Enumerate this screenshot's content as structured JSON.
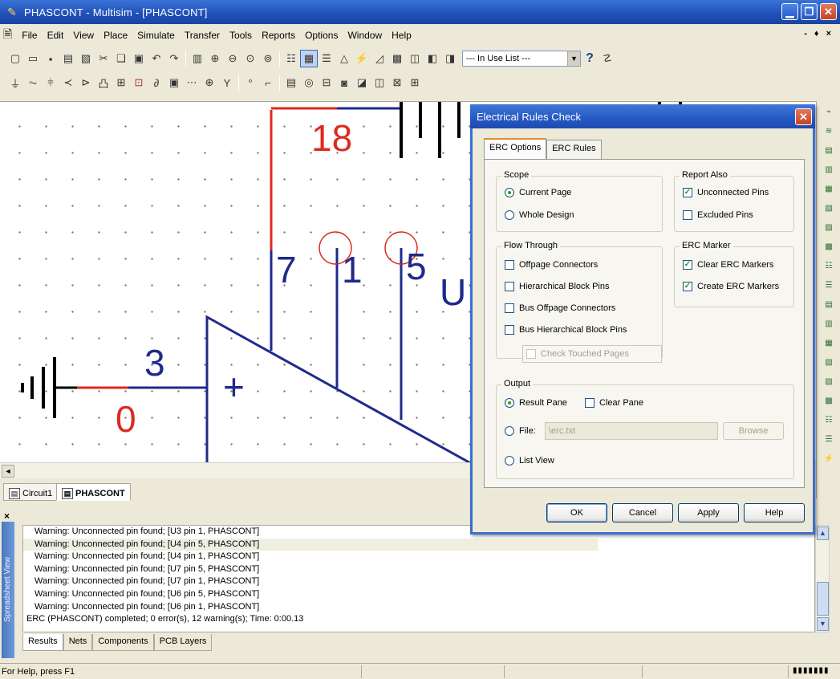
{
  "window": {
    "title": "PHASCONT - Multisim - [PHASCONT]"
  },
  "menu": [
    "File",
    "Edit",
    "View",
    "Place",
    "Simulate",
    "Transfer",
    "Tools",
    "Reports",
    "Options",
    "Window",
    "Help"
  ],
  "toolbar": {
    "in_use_list": "--- In Use List ---",
    "help_icon": "?"
  },
  "schematic": {
    "labels": {
      "n18": "18",
      "n7": "7",
      "n1": "1",
      "n5": "5",
      "nU": "U",
      "n3": "3",
      "n0": "0",
      "plus": "+"
    },
    "colors": {
      "wire_blue": "#1f2a8a",
      "wire_red": "#dd2a1f",
      "grid_dot": "#777777"
    }
  },
  "doc_tabs": [
    "Circuit1",
    "PHASCONT"
  ],
  "results": {
    "lines": [
      "Warning: Unconnected pin found;  [U3 pin 1, PHASCONT]",
      "Warning: Unconnected pin found;  [U4 pin 5, PHASCONT]",
      "Warning: Unconnected pin found;  [U4 pin 1, PHASCONT]",
      "Warning: Unconnected pin found;  [U7 pin 5, PHASCONT]",
      "Warning: Unconnected pin found;  [U7 pin 1, PHASCONT]",
      "Warning: Unconnected pin found;  [U6 pin 5, PHASCONT]",
      "Warning: Unconnected pin found;  [U6 pin 1, PHASCONT]",
      "ERC (PHASCONT) completed;  0 error(s), 12 warning(s);  Time: 0:00.13"
    ],
    "tabs": [
      "Results",
      "Nets",
      "Components",
      "PCB Layers"
    ],
    "side_label": "Spreadsheet View"
  },
  "status": {
    "text": "For Help, press F1"
  },
  "dialog": {
    "title": "Electrical Rules Check",
    "tabs": [
      "ERC Options",
      "ERC Rules"
    ],
    "scope": {
      "title": "Scope",
      "current_page": "Current Page",
      "whole_design": "Whole Design"
    },
    "report_also": {
      "title": "Report Also",
      "unconnected_pins": "Unconnected Pins",
      "excluded_pins": "Excluded Pins"
    },
    "flow_through": {
      "title": "Flow Through",
      "offpage": "Offpage Connectors",
      "hier_block": "Hierarchical Block Pins",
      "bus_offpage": "Bus Offpage Connectors",
      "bus_hier": "Bus Hierarchical Block Pins",
      "check_touched": "Check Touched Pages"
    },
    "erc_marker": {
      "title": "ERC Marker",
      "clear": "Clear ERC Markers",
      "create": "Create ERC Markers"
    },
    "output": {
      "title": "Output",
      "result_pane": "Result Pane",
      "clear_pane": "Clear Pane",
      "file": "File:",
      "file_value": "\\erc.txt",
      "browse": "Browse",
      "list_view": "List View"
    },
    "buttons": {
      "ok": "OK",
      "cancel": "Cancel",
      "apply": "Apply",
      "help": "Help"
    }
  }
}
